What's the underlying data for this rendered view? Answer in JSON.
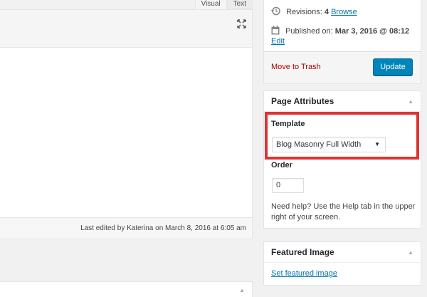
{
  "editor": {
    "tabs": [
      {
        "label": "Visual",
        "active": true
      },
      {
        "label": "Text",
        "active": false
      }
    ],
    "status_text": "Last edited by Katerina on March 8, 2016 at 6:05 am"
  },
  "publish": {
    "revisions_label": "Revisions:",
    "revisions_count": "4",
    "browse_link": "Browse",
    "published_label": "Published on:",
    "published_date": "Mar 3, 2016 @ 08:12",
    "edit_link": "Edit",
    "trash_link": "Move to Trash",
    "update_button": "Update"
  },
  "page_attributes": {
    "title": "Page Attributes",
    "template_label": "Template",
    "template_value": "Blog Masonry Full Width",
    "order_label": "Order",
    "order_value": "0",
    "help_text": "Need help? Use the Help tab in the upper right of your screen."
  },
  "featured_image": {
    "title": "Featured Image",
    "set_link": "Set featured image"
  },
  "colors": {
    "primary_button": "#0085ba",
    "link": "#0073aa",
    "trash": "#aa0000",
    "highlight": "#e03232"
  },
  "icons": {
    "revisions": "history-icon",
    "published": "calendar-icon",
    "expand": "fullscreen-icon",
    "toggle": "collapse-arrow-icon",
    "select": "dropdown-caret-icon"
  }
}
